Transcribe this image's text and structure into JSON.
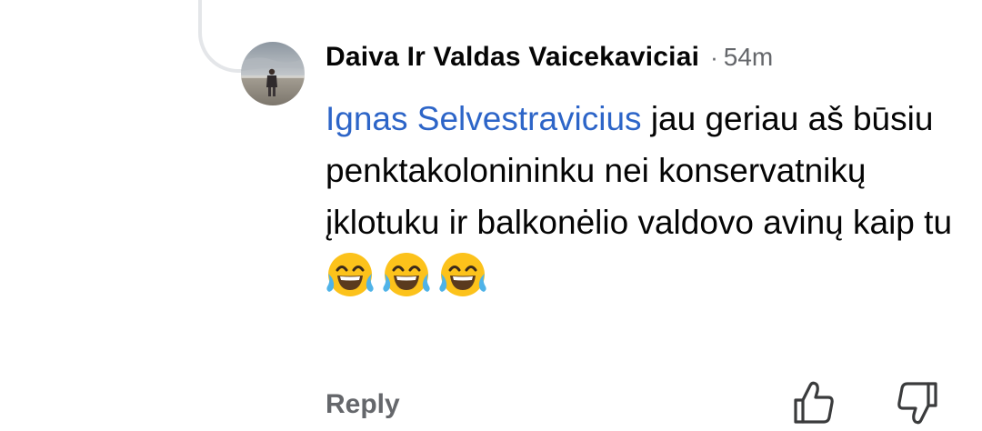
{
  "comment": {
    "author": "Daiva Ir Valdas Vaicekaviciai",
    "separator": "·",
    "time": "54m",
    "mention": "Ignas Selvestravicius",
    "text": " jau geriau aš būsiu penktakolonininku nei konservatnikų įklotuku ir balkonėlio valdovo avinų kaip tu",
    "emojis": [
      "face-with-tears-of-joy",
      "face-with-tears-of-joy",
      "face-with-tears-of-joy"
    ]
  },
  "actions": {
    "reply_label": "Reply",
    "like_icon": "thumbs-up-icon",
    "dislike_icon": "thumbs-down-icon"
  },
  "colors": {
    "mention": "#2d65c8",
    "secondary_text": "#65676b",
    "primary_text": "#050505",
    "emoji_face": "#fcc21b",
    "emoji_tear": "#4fb3e8"
  }
}
